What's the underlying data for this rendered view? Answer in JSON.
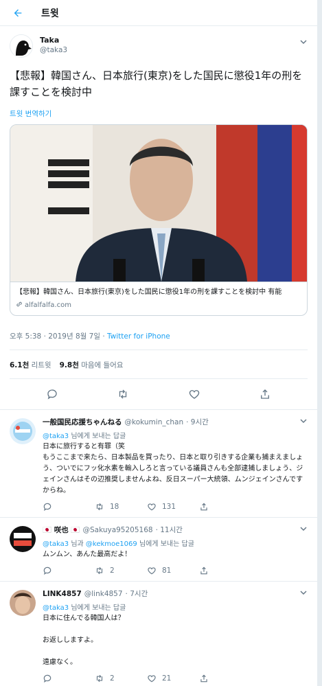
{
  "header": {
    "title": "트윗"
  },
  "tweet": {
    "author_name": "Taka",
    "author_handle": "@taka3",
    "text": "【悲報】韓国さん、日本旅行(東京)をした国民に懲役1年の刑を課すことを検討中",
    "translate_label": "트윗 번역하기",
    "card": {
      "title": "【悲報】韓国さん、日本旅行(東京)をした国民に懲役1年の刑を課すことを検討中 有能",
      "domain": "alfalfalfa.com"
    },
    "meta_time": "오후 5:38 · 2019년 8월 7일 · ",
    "meta_source": "Twitter for iPhone",
    "retweets_count": "6.1천",
    "retweets_label": "리트윗",
    "likes_count": "9.8천",
    "likes_label": "마음에 들어요"
  },
  "replies": [
    {
      "name": "一般国民応援ちゃんねる",
      "handle": "@kokumin_chan",
      "time": "· 9시간",
      "to_mention": "@taka3",
      "to_suffix": " 님에게 보내는 답글",
      "text": "日本に旅行すると有罪（笑\nもうここまで来たら、日本製品を買ったり、日本と取り引きする企業も捕まえましょう、ついでにフッ化水素を輸入しろと言っている議員さんも全部逮捕しましょう、ジェインさんはその辺推奨しませんよね、反日スーパー大統領、ムンジェインさんですからね。",
      "reply_count": "",
      "retweet_count": "18",
      "like_count": "131"
    },
    {
      "name": "咲也",
      "handle": "@Sakuya95205168",
      "time": "· 11시간",
      "to_mention": "@taka3",
      "to_mid": " 님과 ",
      "to_mention2": "@kekmoe1069",
      "to_suffix": " 님에게 보내는 답글",
      "text": "ムンムン、あんた最高だよ！",
      "reply_count": "",
      "retweet_count": "2",
      "like_count": "81"
    },
    {
      "name": "LINK4857",
      "handle": "@link4857",
      "time": "· 7시간",
      "to_mention": "@taka3",
      "to_suffix": " 님에게 보내는 답글",
      "text": "日本に住んでる韓国人は？\n\nお返ししますよ。\n\n遠慮なく。",
      "reply_count": "",
      "retweet_count": "2",
      "like_count": "21"
    }
  ],
  "colors": {
    "accent": "#1da1f2",
    "muted": "#657786",
    "border": "#e6ecf0"
  }
}
